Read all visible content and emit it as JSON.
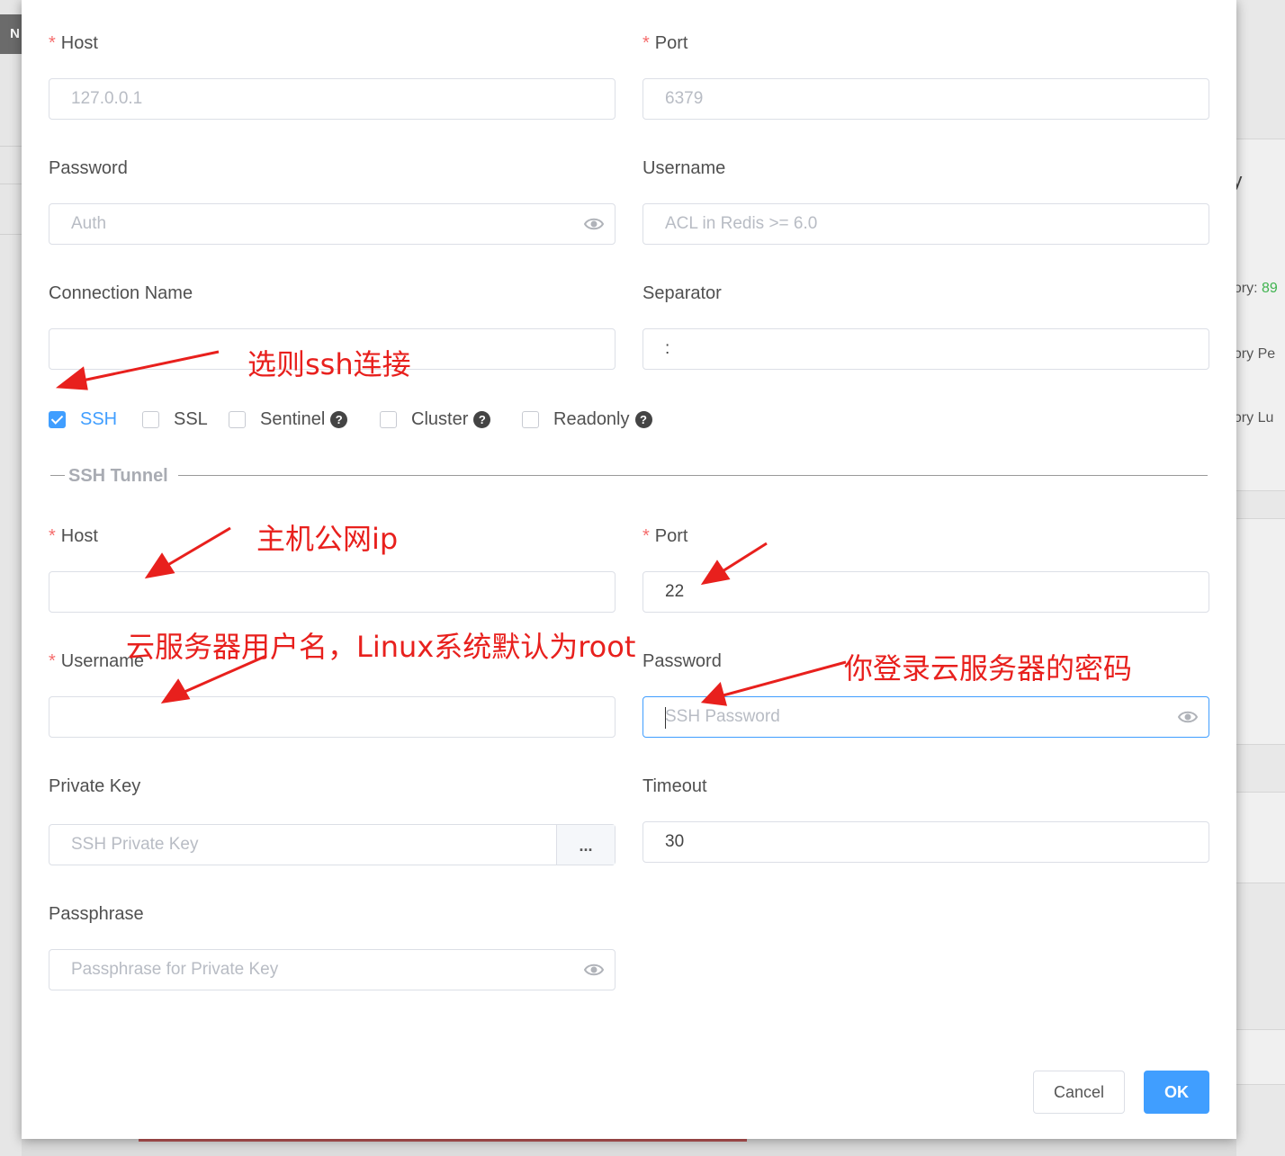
{
  "redis": {
    "host": {
      "label": "Host",
      "placeholder": "127.0.0.1"
    },
    "port": {
      "label": "Port",
      "placeholder": "6379"
    },
    "password": {
      "label": "Password",
      "placeholder": "Auth"
    },
    "username": {
      "label": "Username",
      "placeholder": "ACL in Redis >= 6.0"
    },
    "connection_name": {
      "label": "Connection Name",
      "value": ""
    },
    "separator": {
      "label": "Separator",
      "value": ":"
    }
  },
  "options": [
    {
      "label": "SSH",
      "checked": true
    },
    {
      "label": "SSL",
      "checked": false
    },
    {
      "label": "Sentinel",
      "checked": false,
      "help": "?"
    },
    {
      "label": "Cluster",
      "checked": false,
      "help": "?"
    },
    {
      "label": "Readonly",
      "checked": false,
      "help": "?"
    }
  ],
  "ssh": {
    "section_title": "SSH Tunnel",
    "host": {
      "label": "Host",
      "value": ""
    },
    "port": {
      "label": "Port",
      "value": "22"
    },
    "username": {
      "label": "Username",
      "value": ""
    },
    "password": {
      "label": "Password",
      "placeholder": "SSH Password"
    },
    "private_key": {
      "label": "Private Key",
      "placeholder": "SSH Private Key",
      "browse": "..."
    },
    "timeout": {
      "label": "Timeout",
      "value": "30"
    },
    "passphrase": {
      "label": "Passphrase",
      "placeholder": "Passphrase for Private Key"
    }
  },
  "buttons": {
    "cancel": "Cancel",
    "ok": "OK"
  },
  "annotations": {
    "select_ssh": "选则ssh连接",
    "host_ip": "主机公网ip",
    "username_hint": "云服务器用户名，Linux系统默认为root",
    "password_hint": "你登录云服务器的密码"
  },
  "background": {
    "left_chip": "N",
    "right_texts": [
      "ry",
      "nory: ",
      "89",
      "nory Pe",
      "nory Lu"
    ]
  },
  "colors": {
    "accent": "#409eff",
    "required": "#f56c6c",
    "annotation": "#e8201d"
  },
  "required_mark": "*"
}
